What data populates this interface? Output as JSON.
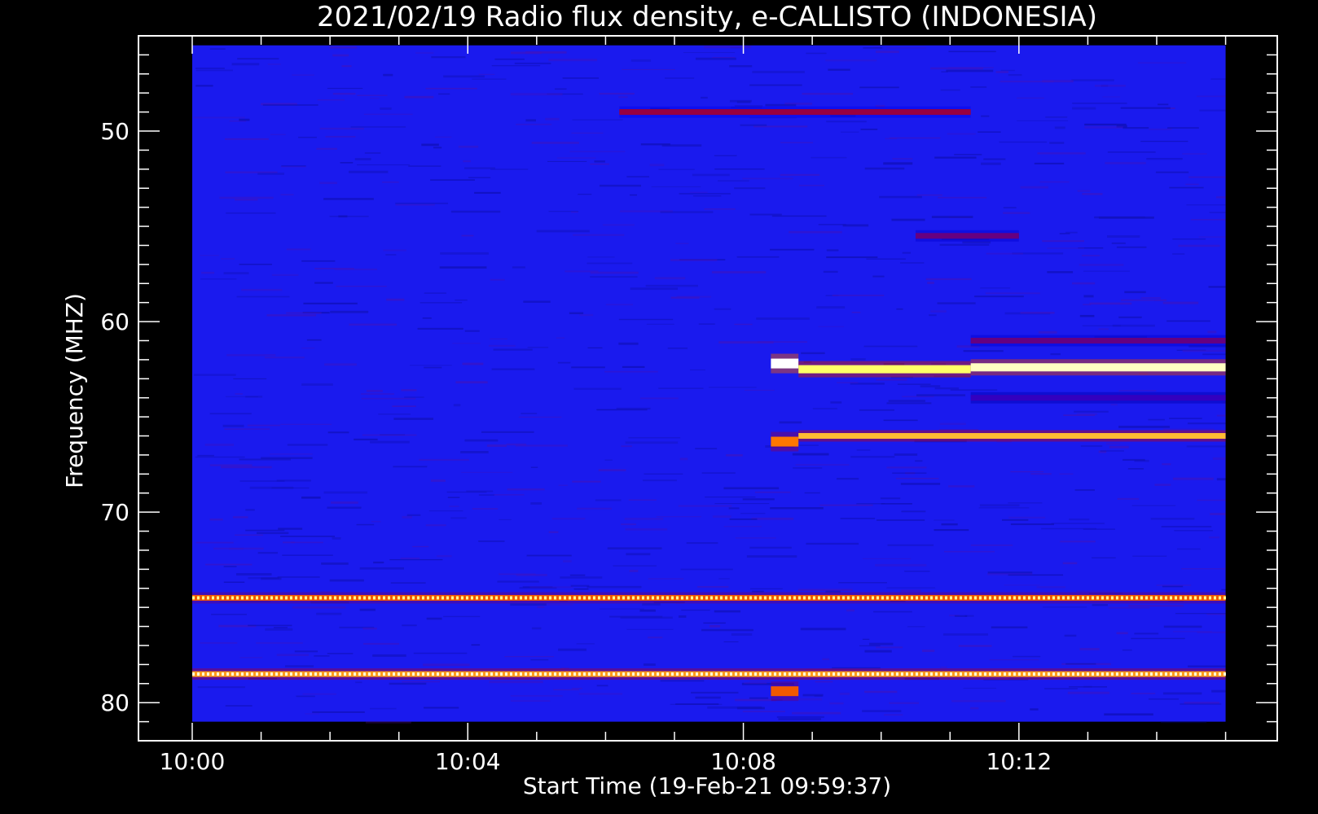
{
  "chart_data": {
    "type": "heatmap",
    "title": "2021/02/19  Radio flux density, e-CALLISTO (INDONESIA)",
    "xlabel": "Start Time (19-Feb-21 09:59:37)",
    "ylabel": "Frequency (MHZ)",
    "x_tick_labels": [
      "10:00",
      "10:04",
      "10:08",
      "10:12"
    ],
    "x_ticks_minutes": [
      0,
      4,
      8,
      12
    ],
    "y_tick_labels": [
      "50",
      "60",
      "70",
      "80"
    ],
    "y_ticks_mhz": [
      50,
      60,
      70,
      80
    ],
    "x_range_minutes": [
      -0.78,
      15.75
    ],
    "y_range_mhz": [
      45,
      82
    ],
    "y_inverted": true,
    "data_x_range_minutes": [
      0,
      15.0
    ],
    "data_y_range_mhz": [
      45.5,
      81
    ],
    "colormap": [
      "#000000",
      "#0000ff",
      "#cc0000",
      "#ff7700",
      "#ffff66",
      "#ffffff"
    ],
    "background_color": "#1a1aee",
    "features": [
      {
        "t_start": 0,
        "t_end": 15.0,
        "freq_mhz": 74.5,
        "intensity": 0.55,
        "kind": "persistent-interference"
      },
      {
        "t_start": 0,
        "t_end": 15.0,
        "freq_mhz": 78.5,
        "intensity": 0.65,
        "kind": "persistent-interference"
      },
      {
        "t_start": 8.4,
        "t_end": 8.8,
        "freq_mhz": 62.2,
        "intensity": 1.0,
        "kind": "burst"
      },
      {
        "t_start": 8.8,
        "t_end": 11.3,
        "freq_mhz": 62.5,
        "intensity": 0.8,
        "kind": "band"
      },
      {
        "t_start": 11.3,
        "t_end": 15.0,
        "freq_mhz": 62.4,
        "intensity": 0.92,
        "kind": "band"
      },
      {
        "t_start": 8.4,
        "t_end": 8.8,
        "freq_mhz": 66.3,
        "intensity": 0.6,
        "kind": "burst"
      },
      {
        "t_start": 8.8,
        "t_end": 15.0,
        "freq_mhz": 66.0,
        "intensity": 0.7,
        "kind": "band"
      },
      {
        "t_start": 6.2,
        "t_end": 11.3,
        "freq_mhz": 49.0,
        "intensity": 0.35,
        "kind": "band"
      },
      {
        "t_start": 10.5,
        "t_end": 12.0,
        "freq_mhz": 55.5,
        "intensity": 0.3,
        "kind": "band"
      },
      {
        "t_start": 8.4,
        "t_end": 8.8,
        "freq_mhz": 79.4,
        "intensity": 0.55,
        "kind": "burst"
      },
      {
        "t_start": 11.3,
        "t_end": 15.0,
        "freq_mhz": 61.0,
        "intensity": 0.3,
        "kind": "band"
      },
      {
        "t_start": 11.3,
        "t_end": 15.0,
        "freq_mhz": 64.0,
        "intensity": 0.25,
        "kind": "band"
      }
    ]
  }
}
